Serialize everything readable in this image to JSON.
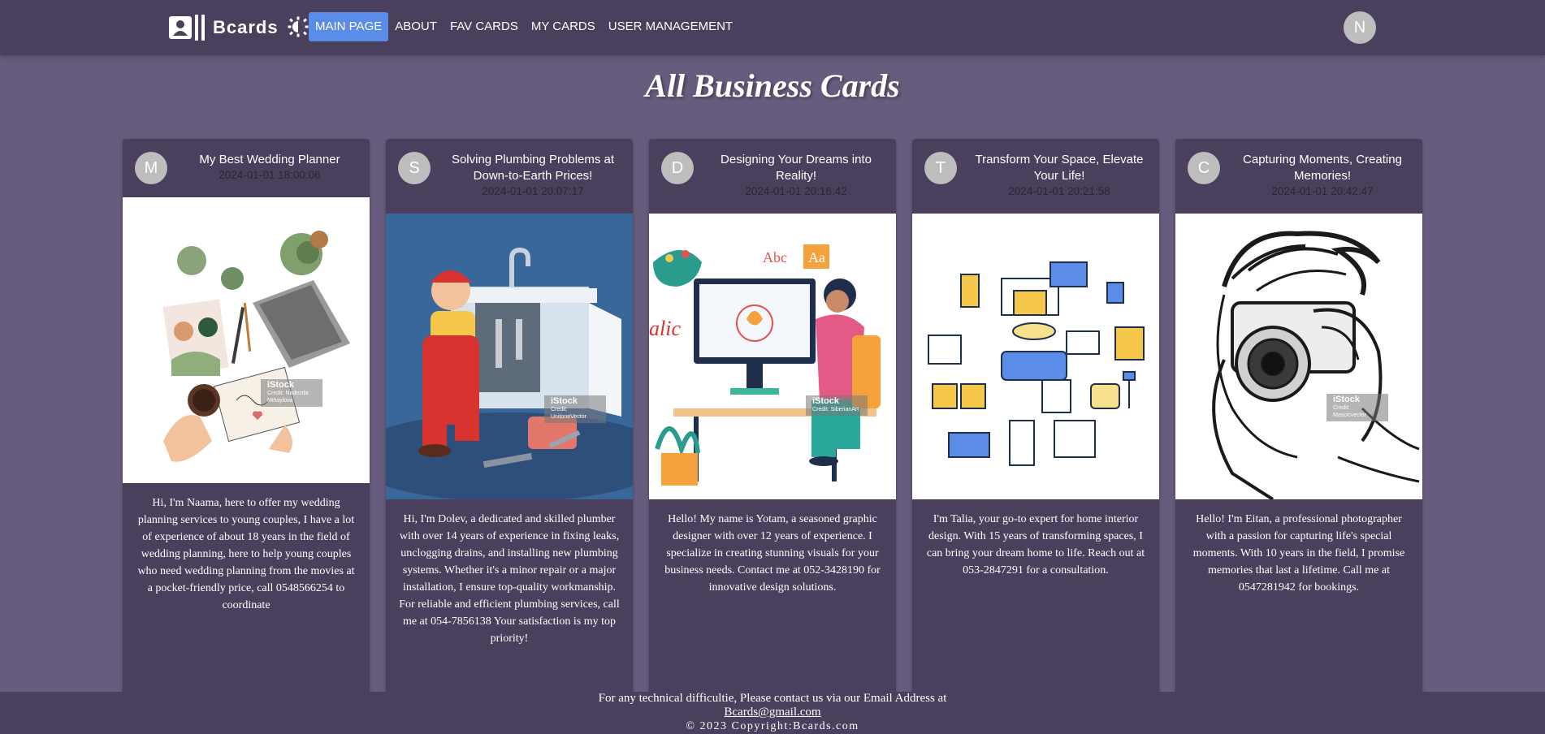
{
  "nav": {
    "brand": "Bcards",
    "links": [
      "MAIN PAGE",
      "ABOUT",
      "FAV CARDS",
      "MY CARDS",
      "USER MANAGEMENT"
    ],
    "user_initial": "N"
  },
  "page_title": "All Business Cards",
  "cards": [
    {
      "initial": "M",
      "title": "My Best Wedding Planner",
      "date": "2024-01-01 18:00:06",
      "description": "Hi, I'm Naama, here to offer my wedding planning services to young couples, I have a lot of experience of about 18 years in the field of wedding planning, here to help young couples who need wedding planning from the movies at a pocket-friendly price, call 0548566254 to coordinate",
      "watermark": "iStock",
      "credit": "Credit: Nadezda Mihaylova"
    },
    {
      "initial": "S",
      "title": "Solving Plumbing Problems at Down-to-Earth Prices!",
      "date": "2024-01-01 20:07:17",
      "description": "Hi, I'm Dolev, a dedicated and skilled plumber with over 14 years of experience in fixing leaks, unclogging drains, and installing new plumbing systems. Whether it's a minor repair or a major installation, I ensure top-quality workmanship. For reliable and efficient plumbing services, call me at 054-7856138 Your satisfaction is my top priority!",
      "watermark": "iStock",
      "credit": "Credit: UnitoneVector"
    },
    {
      "initial": "D",
      "title": "Designing Your Dreams into Reality!",
      "date": "2024-01-01 20:16:42",
      "description": "Hello! My name is Yotam, a seasoned graphic designer with over 12 years of experience. I specialize in creating stunning visuals for your business needs. Contact me at 052-3428190 for innovative design solutions.",
      "watermark": "iStock",
      "credit": "Credit: SiberianArt"
    },
    {
      "initial": "T",
      "title": "Transform Your Space, Elevate Your Life!",
      "date": "2024-01-01 20:21:58",
      "description": "I'm Talia, your go-to expert for home interior design. With 15 years of transforming spaces, I can bring your dream home to life. Reach out at 053-2847291 for a consultation.",
      "watermark": "",
      "credit": ""
    },
    {
      "initial": "C",
      "title": "Capturing Moments, Creating Memories!",
      "date": "2024-01-01 20:42:47",
      "description": "Hello! I'm Eitan, a professional photographer with a passion for capturing life's special moments. With 10 years in the field, I promise memories that last a lifetime. Call me at 0547281942 for bookings.",
      "watermark": "iStock",
      "credit": "Credit: Mascicvector"
    }
  ],
  "footer": {
    "line1": "For any technical difficultie, Please contact us via our Email Address at",
    "email": "Bcards@gmail.com",
    "copyright": "© 2023 Copyright:Bcards.com"
  },
  "colors": {
    "background": "#675c7d",
    "navbar": "#4a3f5c",
    "card": "#4a3f5c",
    "active_link": "#5b8de8"
  }
}
